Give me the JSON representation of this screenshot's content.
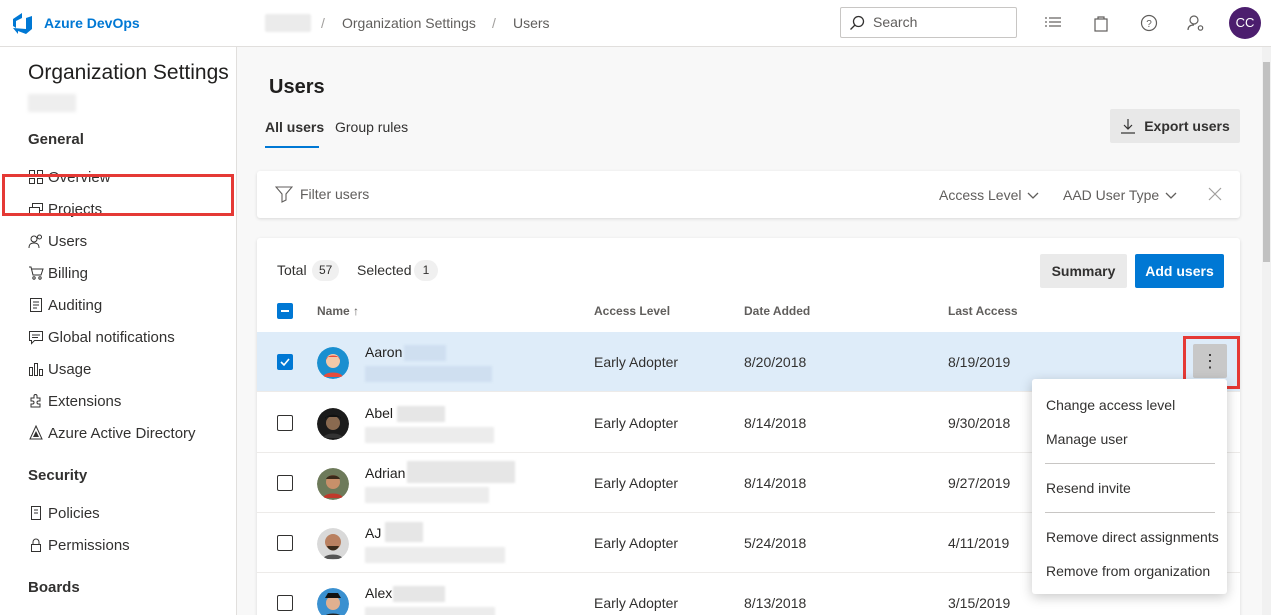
{
  "header": {
    "brand": "Azure DevOps",
    "breadcrumbs": [
      "Organization Settings",
      "Users"
    ],
    "search_placeholder": "Search",
    "avatar_initials": "CC"
  },
  "sidebar": {
    "title": "Organization Settings",
    "sections": {
      "general": "General",
      "security": "Security",
      "boards": "Boards"
    },
    "items": [
      {
        "label": "Overview",
        "icon": "overview-icon"
      },
      {
        "label": "Projects",
        "icon": "projects-icon"
      },
      {
        "label": "Users",
        "icon": "users-icon"
      },
      {
        "label": "Billing",
        "icon": "cart-icon"
      },
      {
        "label": "Auditing",
        "icon": "auditing-icon"
      },
      {
        "label": "Global notifications",
        "icon": "notifications-icon"
      },
      {
        "label": "Usage",
        "icon": "usage-icon"
      },
      {
        "label": "Extensions",
        "icon": "extensions-icon"
      },
      {
        "label": "Azure Active Directory",
        "icon": "aad-icon"
      },
      {
        "label": "Policies",
        "icon": "policies-icon"
      },
      {
        "label": "Permissions",
        "icon": "lock-icon"
      }
    ]
  },
  "main": {
    "title": "Users",
    "tabs": [
      "All users",
      "Group rules"
    ],
    "export_label": "Export users",
    "filter": {
      "placeholder": "Filter users",
      "access_level": "Access Level",
      "aad_type": "AAD User Type"
    },
    "stats": {
      "total_label": "Total",
      "total": "57",
      "selected_label": "Selected",
      "selected": "1"
    },
    "summary_label": "Summary",
    "add_label": "Add users",
    "columns": [
      "Name",
      "Access Level",
      "Date Added",
      "Last Access"
    ],
    "rows": [
      {
        "first": "Aaron",
        "access": "Early Adopter",
        "added": "8/20/2018",
        "last": "8/19/2019",
        "selected": true
      },
      {
        "first": "Abel",
        "access": "Early Adopter",
        "added": "8/14/2018",
        "last": "9/30/2018",
        "selected": false
      },
      {
        "first": "Adrian",
        "access": "Early Adopter",
        "added": "8/14/2018",
        "last": "9/27/2019",
        "selected": false
      },
      {
        "first": "AJ",
        "access": "Early Adopter",
        "added": "5/24/2018",
        "last": "4/11/2019",
        "selected": false
      },
      {
        "first": "Alex",
        "access": "Early Adopter",
        "added": "8/13/2018",
        "last": "3/15/2019",
        "selected": false
      }
    ],
    "more_symbol": "⋮",
    "sort_symbol": "↑"
  },
  "context_menu": {
    "items": [
      "Change access level",
      "Manage user",
      "Resend invite",
      "Remove direct assignments",
      "Remove from organization"
    ]
  },
  "colors": {
    "accent": "#0078d4",
    "highlight": "#e53935",
    "selected_row": "#deecf9"
  }
}
